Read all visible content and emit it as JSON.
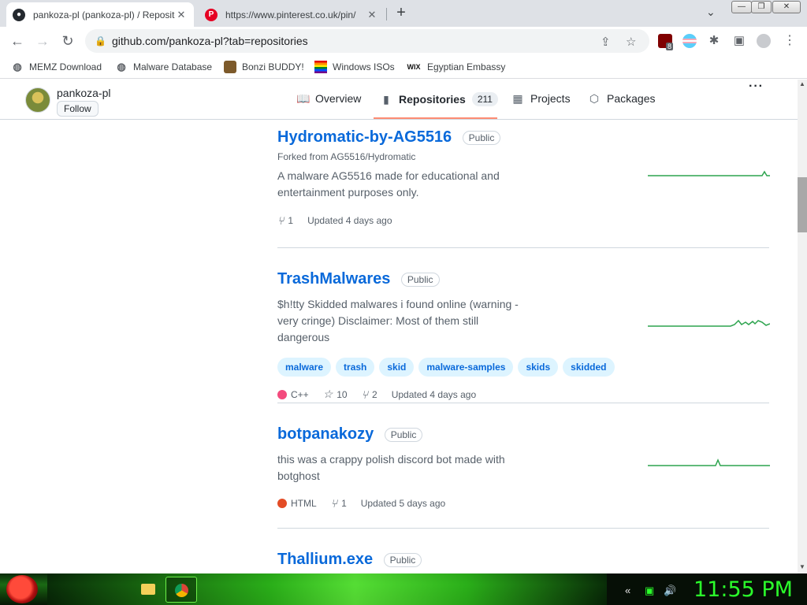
{
  "browser": {
    "tabs": [
      {
        "title": "pankoza-pl (pankoza-pl) / Repositories",
        "active": true
      },
      {
        "title": "https://www.pinterest.co.uk/pin/",
        "active": false
      }
    ],
    "url": "github.com/pankoza-pl?tab=repositories",
    "extension_badge": "8"
  },
  "bookmarks": [
    {
      "label": "MEMZ Download"
    },
    {
      "label": "Malware Database"
    },
    {
      "label": "Bonzi BUDDY!"
    },
    {
      "label": "Windows ISOs"
    },
    {
      "label": "Egyptian Embassy"
    }
  ],
  "profile": {
    "username": "pankoza-pl",
    "follow_label": "Follow"
  },
  "nav": {
    "overview": "Overview",
    "repositories": "Repositories",
    "repo_count": "211",
    "projects": "Projects",
    "packages": "Packages"
  },
  "repos": [
    {
      "name": "Hydromatic-by-AG5516",
      "visibility": "Public",
      "forked_from": "Forked from AG5516/Hydromatic",
      "description": "A malware AG5516 made for educational and entertainment purposes only.",
      "forks": "1",
      "updated": "Updated 4 days ago"
    },
    {
      "name": "TrashMalwares",
      "visibility": "Public",
      "description": "$h!tty Skidded malwares i found online (warning - very cringe) Disclaimer: Most of them still dangerous",
      "topics": [
        "malware",
        "trash",
        "skid",
        "malware-samples",
        "skids",
        "skidded"
      ],
      "language": "C++",
      "language_color": "#f34b7d",
      "stars": "10",
      "forks": "2",
      "updated": "Updated 4 days ago"
    },
    {
      "name": "botpanakozy",
      "visibility": "Public",
      "description": "this was a crappy polish discord bot made with botghost",
      "language": "HTML",
      "language_color": "#e34c26",
      "forks": "1",
      "updated": "Updated 5 days ago"
    },
    {
      "name": "Thallium.exe",
      "visibility": "Public"
    }
  ],
  "taskbar": {
    "clock": "11:55 PM"
  },
  "colors": {
    "link": "#0969da",
    "accent_underline": "#fd8c73",
    "sparkline": "#2da44e"
  }
}
